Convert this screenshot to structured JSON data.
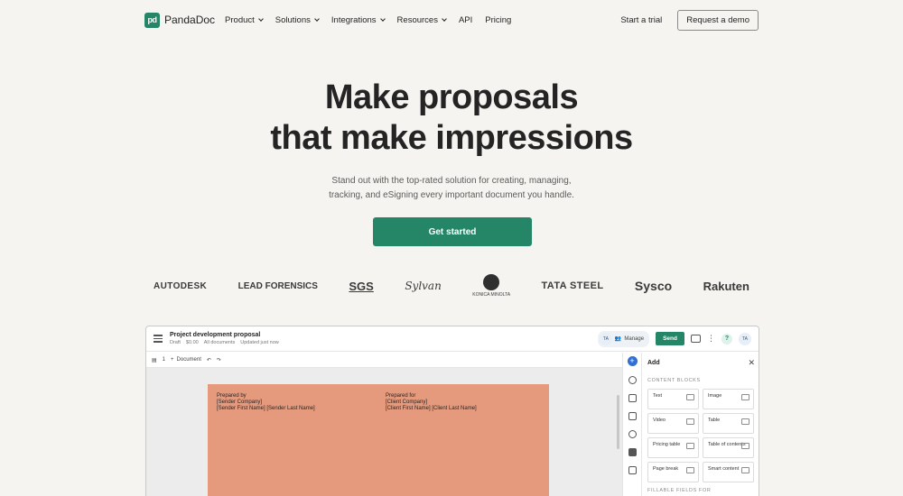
{
  "nav": {
    "logo_mark": "pd",
    "logo_text": "PandaDoc",
    "menu": [
      "Product",
      "Solutions",
      "Integrations",
      "Resources",
      "API",
      "Pricing"
    ],
    "trial": "Start a trial",
    "demo": "Request a demo"
  },
  "hero": {
    "headline_1": "Make proposals",
    "headline_2": "that make impressions",
    "sub_1": "Stand out with the top-rated solution for creating, managing,",
    "sub_2": "tracking, and eSigning every important document you handle.",
    "cta": "Get started"
  },
  "logos": {
    "autodesk": "AUTODESK",
    "lead": "LEAD FORENSICS",
    "sgs": "SGS",
    "sylvan": "Sylvan",
    "konica": "KONICA MINOLTA",
    "tata": "TATA STEEL",
    "sysco": "Sysco",
    "rakuten": "Rakuten"
  },
  "app": {
    "title": "Project development proposal",
    "meta": [
      "Draft",
      "$0.00",
      "All documents",
      "Updated just now"
    ],
    "avatar": "TA",
    "manage": "Manage",
    "send": "Send",
    "help": "?",
    "toolbar": {
      "pages": "1",
      "document": "Document"
    },
    "page": {
      "sender": [
        "Prepared by",
        "[Sender Company]",
        "[Sender First Name] [Sender Last Name]"
      ],
      "client": [
        "Prepared for",
        "[Client Company]",
        "[Client First Name] [Client Last Name]"
      ]
    },
    "panel": {
      "title": "Add",
      "section": "CONTENT BLOCKS",
      "blocks": [
        "Text",
        "Image",
        "Video",
        "Table",
        "Pricing table",
        "Table of contents",
        "Page break",
        "Smart content"
      ],
      "section2": "FILLABLE FIELDS FOR"
    }
  }
}
